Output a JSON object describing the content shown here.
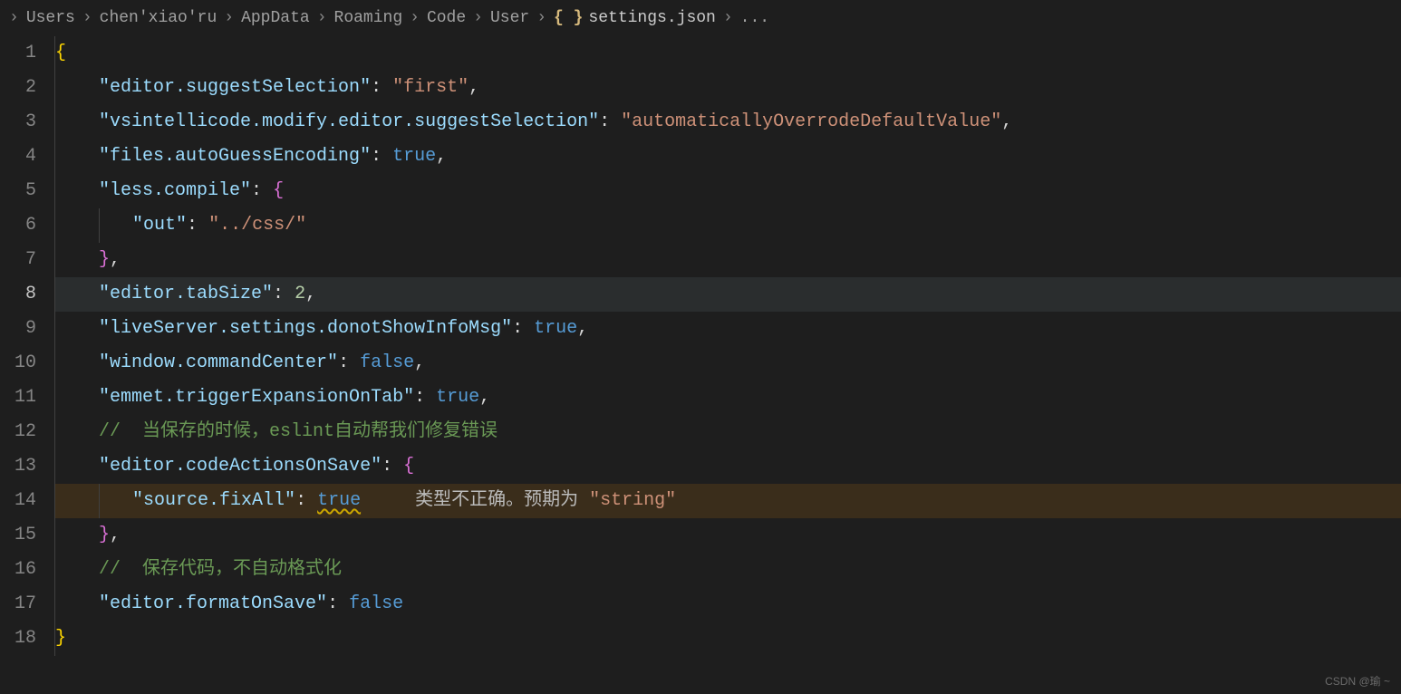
{
  "breadcrumb": {
    "items": [
      "Users",
      "chen'xiao'ru",
      "AppData",
      "Roaming",
      "Code",
      "User"
    ],
    "file_icon_text": "{ }",
    "filename": "settings.json",
    "trailing": "..."
  },
  "editor": {
    "active_line": 8,
    "line_numbers": [
      "1",
      "2",
      "3",
      "4",
      "5",
      "6",
      "7",
      "8",
      "9",
      "10",
      "11",
      "12",
      "13",
      "14",
      "15",
      "16",
      "17",
      "18"
    ],
    "code": {
      "l1_open_brace": "{",
      "l2_key": "\"editor.suggestSelection\"",
      "l2_colon": ": ",
      "l2_val": "\"first\"",
      "l2_comma": ",",
      "l3_key": "\"vsintellicode.modify.editor.suggestSelection\"",
      "l3_colon": ": ",
      "l3_val": "\"automaticallyOverrodeDefaultValue\"",
      "l3_comma": ",",
      "l4_key": "\"files.autoGuessEncoding\"",
      "l4_colon": ": ",
      "l4_val": "true",
      "l4_comma": ",",
      "l5_key": "\"less.compile\"",
      "l5_colon": ": ",
      "l5_brace": "{",
      "l6_key": "\"out\"",
      "l6_colon": ": ",
      "l6_val": "\"../css/\"",
      "l7_brace": "}",
      "l7_comma": ",",
      "l8_key": "\"editor.tabSize\"",
      "l8_colon": ": ",
      "l8_val": "2",
      "l8_comma": ",",
      "l9_key": "\"liveServer.settings.donotShowInfoMsg\"",
      "l9_colon": ": ",
      "l9_val": "true",
      "l9_comma": ",",
      "l10_key": "\"window.commandCenter\"",
      "l10_colon": ": ",
      "l10_val": "false",
      "l10_comma": ",",
      "l11_key": "\"emmet.triggerExpansionOnTab\"",
      "l11_colon": ": ",
      "l11_val": "true",
      "l11_comma": ",",
      "l12_comment": "//  当保存的时候，eslint自动帮我们修复错误",
      "l13_key": "\"editor.codeActionsOnSave\"",
      "l13_colon": ": ",
      "l13_brace": "{",
      "l14_key": "\"source.fixAll\"",
      "l14_colon": ": ",
      "l14_val": "true",
      "l14_inlay_prefix": "     类型不正确。预期为 ",
      "l14_inlay_type": "\"string\"",
      "l15_brace": "}",
      "l15_comma": ",",
      "l16_comment": "//  保存代码，不自动格式化",
      "l17_key": "\"editor.formatOnSave\"",
      "l17_colon": ": ",
      "l17_val": "false",
      "l18_close_brace": "}"
    }
  },
  "watermark": "CSDN @瑜 ~"
}
